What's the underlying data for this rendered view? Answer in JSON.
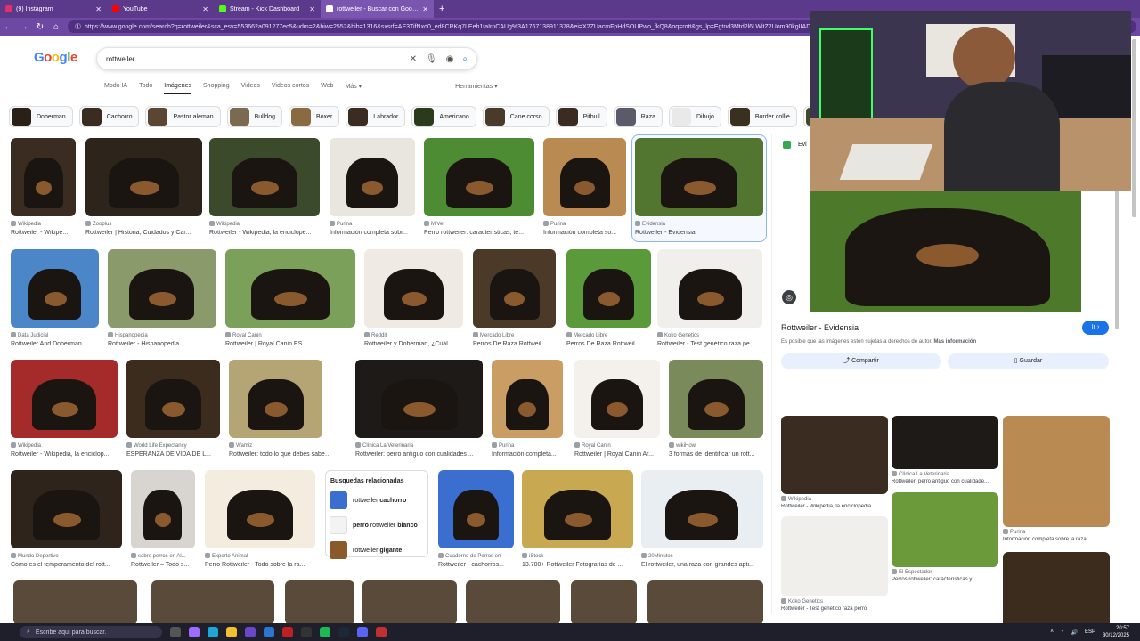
{
  "tabs": [
    {
      "label": "(9) Instagram",
      "color": "#e1306c"
    },
    {
      "label": "YouTube",
      "color": "#ff0000"
    },
    {
      "label": "Stream - Kick Dashboard",
      "color": "#53fc18"
    },
    {
      "label": "rottweiler - Buscar con Google",
      "color": "#ffffff"
    }
  ],
  "url": "https://www.google.com/search?q=rottweiler&sca_esv=553662a091277ec5&udm=2&biw=2552&bih=1316&sxsrf=AE3TifNxd0_ed8CRKq7LEeh1taIrnCAUg%3A1767138911378&ei=X2ZUacmFpHdSOUPwo_fkQ8&oq=rott&gs_lp=Egtnd3Mtd2l6LWltZ2Uom90kgIIADINEAAYgAQYsQMYQxiKBTIRLEAAY",
  "search": {
    "query": "rottweiler"
  },
  "nav": [
    "Modo IA",
    "Todo",
    "Imágenes",
    "Shopping",
    "Videos",
    "Videos cortos",
    "Web",
    "Más ▾"
  ],
  "tools": "Herramientas ▾",
  "chips": [
    "Doberman",
    "Cachorro",
    "Pastor aleman",
    "Bulldog",
    "Boxer",
    "Labrador",
    "Americano",
    "Cane corso",
    "Pitbull",
    "Raza",
    "Dibujo",
    "Border collie",
    "Go"
  ],
  "results": [
    {
      "src": "Wikipedia",
      "cap": "Rottweiler - Wikipe...",
      "c": "#3a2c20"
    },
    {
      "src": "Zooplus",
      "cap": "Rottweiler | Historia, Cuidados y Car...",
      "c": "#2d241b"
    },
    {
      "src": "Wikipedia",
      "cap": "Rottweiler - Wikipedia, la enciclope...",
      "c": "#3b4a2a"
    },
    {
      "src": "Purina",
      "cap": "Información completa sobr...",
      "c": "#e9e5df"
    },
    {
      "src": "MiVet",
      "cap": "Perro rottweiler: características, te...",
      "c": "#4e8c34"
    },
    {
      "src": "Purina",
      "cap": "Información completa so...",
      "c": "#b98b52"
    },
    {
      "src": "Evidensia",
      "cap": "Rottweiler - Evidensia",
      "c": "#52752f"
    },
    {
      "src": "Data Judicial",
      "cap": "Rottweiler And Doberman ...",
      "c": "#4a86c8"
    },
    {
      "src": "Hispanopedia",
      "cap": "Rottweiler - Hispanopedia",
      "c": "#8a9a6a"
    },
    {
      "src": "Royal Canin",
      "cap": "Rottweiler | Royal Canin ES",
      "c": "#7aa05a"
    },
    {
      "src": "Reddit",
      "cap": "Rottweiler y Doberman, ¿Cuál ...",
      "c": "#efeae4"
    },
    {
      "src": "Mercado Libre",
      "cap": "Perros De Raza Rottweil...",
      "c": "#4b3a28"
    },
    {
      "src": "Mercado Libre",
      "cap": "Perros De Raza Rottweil...",
      "c": "#5a9a3a"
    },
    {
      "src": "Koko Genetics",
      "cap": "Rottweiler - Test genético raza pe...",
      "c": "#f1efec"
    },
    {
      "src": "Wikipedia",
      "cap": "Rottweiler - Wikipedia, la enciclop...",
      "c": "#a52a2a"
    },
    {
      "src": "World Life Expectancy",
      "cap": "ESPERANZA DE VIDA DE L...",
      "c": "#3b2c1e"
    },
    {
      "src": "Wamiz",
      "cap": "Rottweiler: todo lo que debes saber s...",
      "c": "#b5a575"
    },
    {
      "src": "Clínica La Veterinaria",
      "cap": "Rottweiler: perro antiguo con cualidades ...",
      "c": "#1e1a17"
    },
    {
      "src": "Purina",
      "cap": "Información completa...",
      "c": "#c99d63"
    },
    {
      "src": "Royal Canin",
      "cap": "Rottweiler | Royal Canin Ar...",
      "c": "#f4f1ec"
    },
    {
      "src": "wikiHow",
      "cap": "3 formas de identificar un rott...",
      "c": "#7a8a5a"
    },
    {
      "src": "Mundo Deportivo",
      "cap": "Cómo es el temperamento del rott...",
      "c": "#2f241b"
    },
    {
      "src": "sobre perros en Al...",
      "cap": "Rottweiler – Todo s...",
      "c": "#d8d4cf"
    },
    {
      "src": "Experto Animal",
      "cap": "Perro Rottweiler - Todo sobre la ra...",
      "c": "#f3ecdf"
    },
    {
      "src": "Cuaderno de Perros en",
      "cap": "Rottweiler - cachorros...",
      "c": "#3a6fd0"
    },
    {
      "src": "iStock",
      "cap": "13.700+ Rottweiler Fotografías de ...",
      "c": "#c8a850"
    },
    {
      "src": "20Minutos",
      "cap": "El rottweiler, una raza con grandes apti...",
      "c": "#e8eef2"
    }
  ],
  "related": {
    "title": "Busquedas relacionadas",
    "items": [
      {
        "prefix": "rottweiler ",
        "bold": "cachorro"
      },
      {
        "prefix": "perro ",
        "mid": "rottweiler ",
        "bold": "blanco"
      },
      {
        "prefix": "rottweiler ",
        "bold": "gigante"
      }
    ]
  },
  "panel": {
    "source": "Evi",
    "title": "Rottweiler - Evidensia",
    "go": "Ir ›",
    "note": "Es posible que las imágenes estén sujetas a derechos de autor.",
    "note_link": "Más información",
    "share": "Compartir",
    "save": "Guardar",
    "related": [
      {
        "src": "Wikipedia",
        "cap": "Rottweiler - Wikipedia, la enciclopedia...",
        "c": "#3a2c20"
      },
      {
        "src": "Clínica La Veterinaria",
        "cap": "Rottweiler: perro antiguo con cualidade...",
        "c": "#1e1a17"
      },
      {
        "src": "Purina",
        "cap": "Información completa sobre la raza...",
        "c": "#b98b52"
      },
      {
        "src": "Koko Genetics",
        "cap": "Rottweiler - Test genético raza perro",
        "c": "#f1efec"
      },
      {
        "src": "El Espectador",
        "cap": "Perros rottweiler: características y...",
        "c": "#6a9a3a"
      },
      {
        "src": "World Life Expectancy",
        "cap": "",
        "c": "#3b2c1e"
      }
    ]
  },
  "taskbar": {
    "search": "Escribe aquí para buscar.",
    "lang": "ESP",
    "time": "20:57",
    "date": "30/12/2025"
  }
}
